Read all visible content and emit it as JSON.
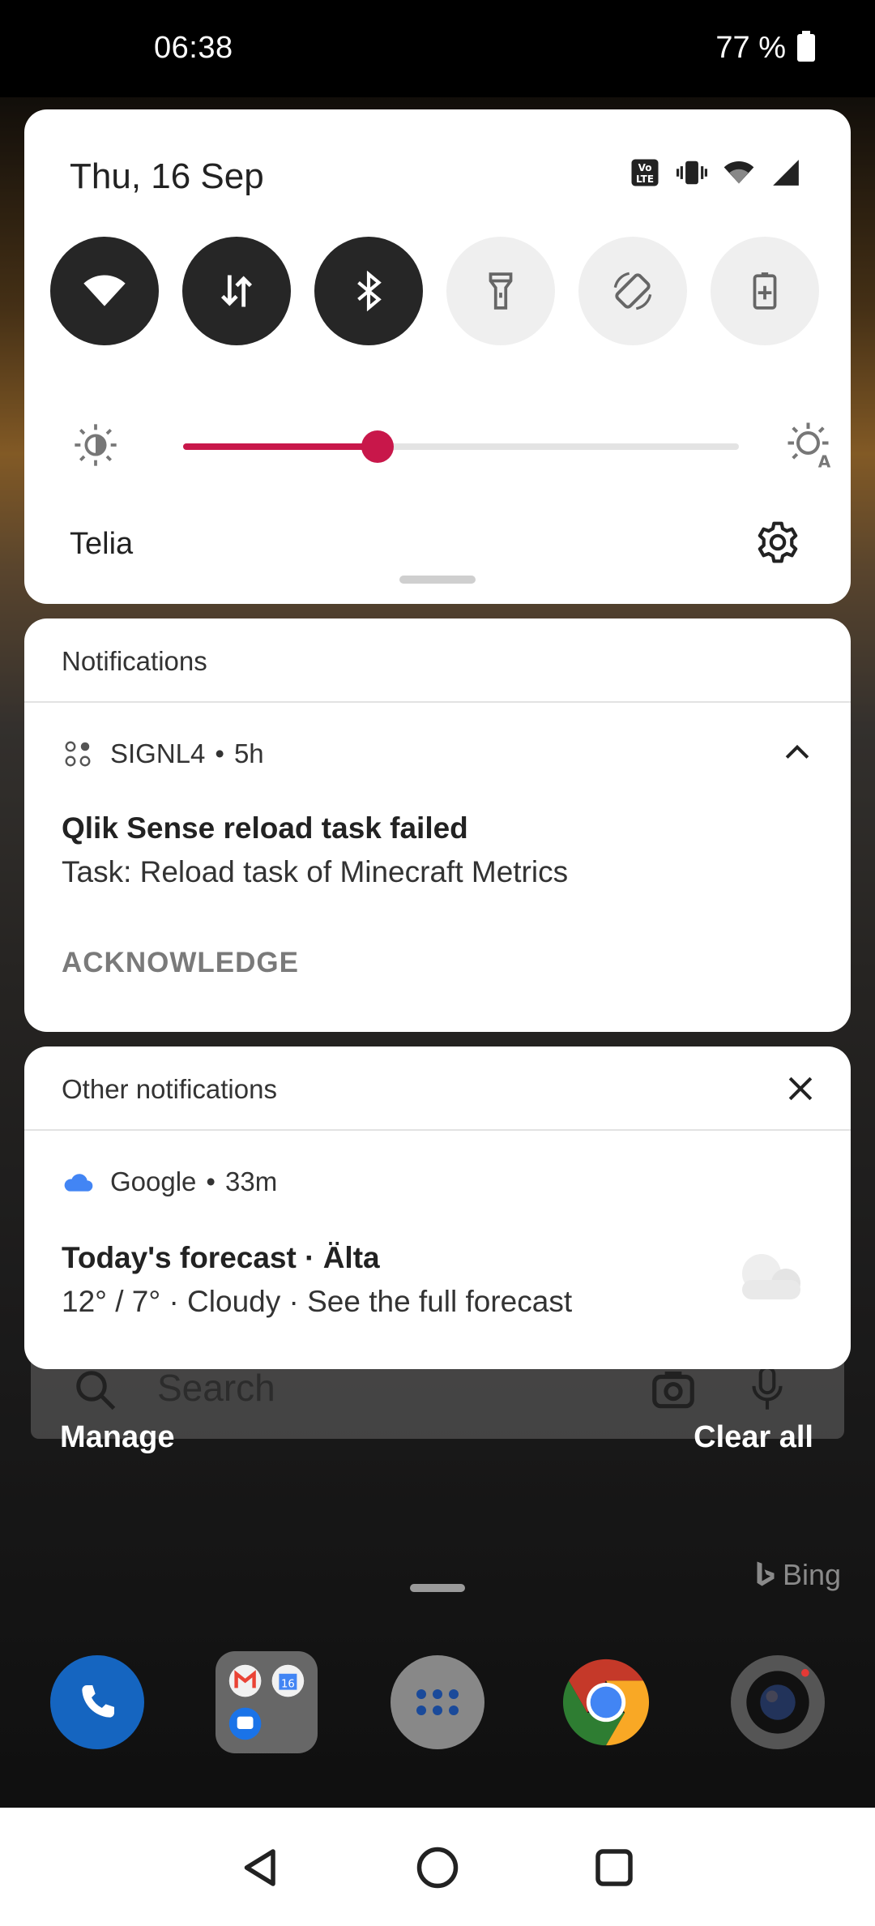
{
  "status_bar": {
    "time": "06:38",
    "battery": "77 %"
  },
  "quick_settings": {
    "date": "Thu, 16 Sep",
    "indicators": [
      "volte-icon",
      "vibrate-icon",
      "wifi-icon",
      "cell-signal-icon"
    ],
    "tiles": [
      {
        "name": "wifi",
        "icon": "wifi-icon",
        "active": true
      },
      {
        "name": "mobile-data",
        "icon": "data-arrows-icon",
        "active": true
      },
      {
        "name": "bluetooth",
        "icon": "bluetooth-icon",
        "active": true
      },
      {
        "name": "flashlight",
        "icon": "flashlight-icon",
        "active": false
      },
      {
        "name": "auto-rotate",
        "icon": "rotate-icon",
        "active": false
      },
      {
        "name": "battery-saver",
        "icon": "battery-saver-icon",
        "active": false
      }
    ],
    "brightness_level": 0.35,
    "carrier": "Telia",
    "accent_color": "#c8174a"
  },
  "notifications": {
    "header": "Notifications",
    "items": [
      {
        "app": "SIGNL4",
        "age": "5h",
        "title": "Qlik Sense reload task failed",
        "body": "Task: Reload task of Minecraft Metrics",
        "action": "ACKNOWLEDGE"
      }
    ]
  },
  "other_notifications": {
    "header": "Other notifications",
    "items": [
      {
        "app": "Google",
        "age": "33m",
        "title": "Today's forecast · Älta",
        "body": "12° / 7° · Cloudy · See the full forecast",
        "icon": "cloudy-icon"
      }
    ]
  },
  "home": {
    "search_placeholder": "Search",
    "bing_label": "Bing",
    "dock": [
      "phone-icon",
      "folder-icon",
      "app-drawer-icon",
      "chrome-icon",
      "camera-icon"
    ]
  },
  "footer": {
    "manage": "Manage",
    "clear_all": "Clear all"
  }
}
